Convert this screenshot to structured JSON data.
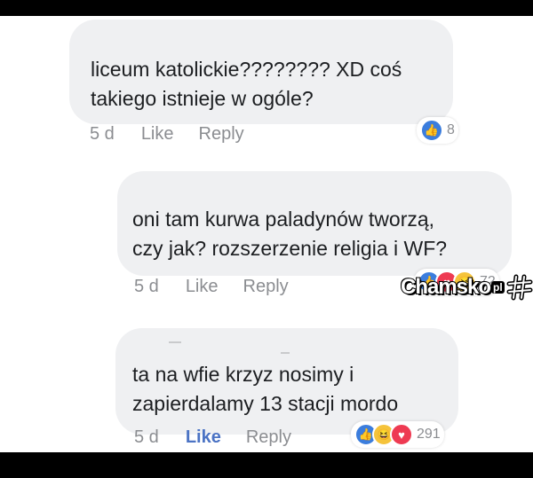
{
  "comments": [
    {
      "text": "liceum katolickie???????? XD coś\ntakiego istnieje w ogóle?",
      "time": "5 d",
      "like": "Like",
      "reply": "Reply",
      "reactions": [
        "like"
      ],
      "count": "8",
      "liked": false
    },
    {
      "text": "oni tam kurwa paladynów tworzą,\nczy jak? rozszerzenie religia i WF?",
      "time": "5 d",
      "like": "Like",
      "reply": "Reply",
      "reactions": [
        "like",
        "love",
        "haha"
      ],
      "count": "72",
      "liked": false
    },
    {
      "text": "ta na wfie krzyz nosimy i\nzapierdalamy 13 stacji mordo",
      "time": "5 d",
      "like": "Like",
      "reply": "Reply",
      "reactions": [
        "like",
        "haha",
        "love"
      ],
      "count": "291",
      "liked": true
    }
  ],
  "watermark": {
    "brand": "Chamsko",
    "tld": "pl"
  },
  "colors": {
    "bubble": "#eff0f2",
    "like_blue": "#3b7ddd",
    "love_red": "#ee3a52",
    "haha_yellow": "#f5c33b"
  }
}
